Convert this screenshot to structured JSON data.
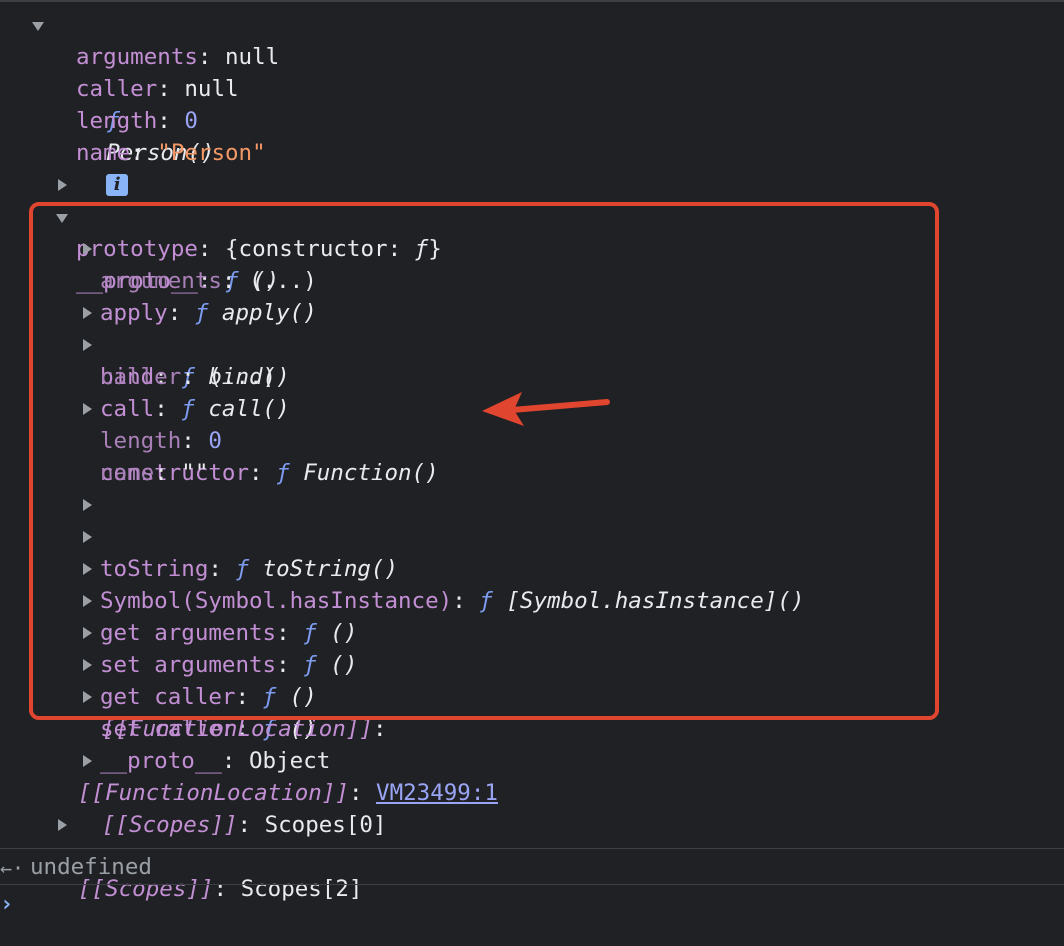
{
  "tree": {
    "root_fn": "ƒ",
    "root_name": "Person()",
    "info_glyph": "i",
    "arguments_key": "arguments",
    "arguments_val": "null",
    "caller_key": "caller",
    "caller_val": "null",
    "length_key": "length",
    "length_val": "0",
    "name_key": "name",
    "name_val": "\"Person\"",
    "prototype_key": "prototype",
    "prototype_val_a": "{constructor: ",
    "prototype_val_f": "ƒ",
    "prototype_val_b": "}",
    "proto_key": "__proto__",
    "proto_fn": "ƒ",
    "proto_val": "()",
    "proto_children": [
      {
        "key": "apply",
        "fn": "ƒ",
        "val": "apply()"
      },
      {
        "key": "arguments",
        "val": "(...)"
      },
      {
        "key": "bind",
        "fn": "ƒ",
        "val": "bind()"
      },
      {
        "key": "call",
        "fn": "ƒ",
        "val": "call()"
      },
      {
        "key": "caller",
        "val": "(...)"
      },
      {
        "key": "constructor",
        "fn": "ƒ",
        "val": "Function()"
      },
      {
        "key": "length",
        "val": "0"
      },
      {
        "key": "name",
        "val": "\"\""
      },
      {
        "key": "toString",
        "fn": "ƒ",
        "val": "toString()"
      },
      {
        "key": "Symbol(Symbol.hasInstance)",
        "fn": "ƒ",
        "val": "[Symbol.hasInstance]()"
      },
      {
        "key_a": "get ",
        "key": "arguments",
        "fn": "ƒ",
        "val": "()"
      },
      {
        "key_a": "set ",
        "key": "arguments",
        "fn": "ƒ",
        "val": "()"
      },
      {
        "key_a": "get ",
        "key": "caller",
        "fn": "ƒ",
        "val": "()"
      },
      {
        "key_a": "set ",
        "key": "caller",
        "fn": "ƒ",
        "val": "()"
      },
      {
        "key": "__proto__",
        "val": "Object"
      }
    ],
    "inner_fnloc_key": "[[FunctionLocation]]",
    "inner_fnloc_colon": ":",
    "inner_scopes_key": "[[Scopes]]",
    "inner_scopes_val": "Scopes[0]",
    "outer_fnloc_key": "[[FunctionLocation]]",
    "outer_fnloc_link": "VM23499:1",
    "outer_scopes_key": "[[Scopes]]",
    "outer_scopes_val": "Scopes[2]"
  },
  "console": {
    "result_arrow": "←·",
    "result_text": "undefined",
    "prompt_glyph": "›"
  },
  "colors": {
    "background": "#202124",
    "key_purple": "#c38fd4",
    "function_blue": "#7d9cf0",
    "string_orange": "#f29766",
    "number_blue": "#9aa4f5",
    "highlight_red": "#e0452f"
  }
}
